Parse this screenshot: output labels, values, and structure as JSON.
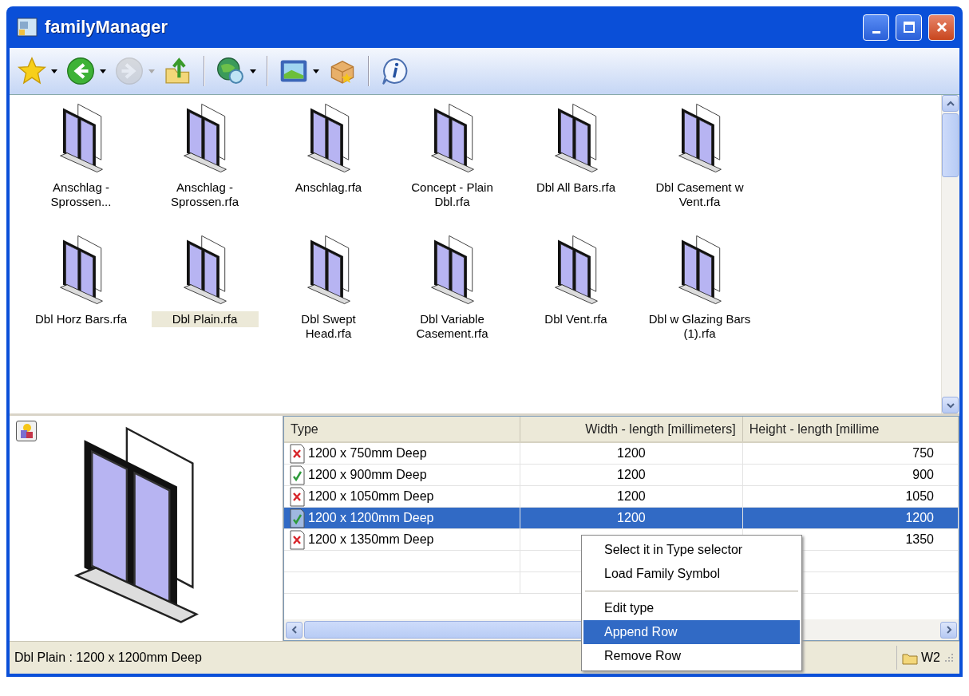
{
  "window": {
    "title": "familyManager"
  },
  "toolbar": [
    {
      "kind": "button",
      "dropdown": true,
      "disabled": false
    },
    {
      "kind": "button",
      "dropdown": true,
      "disabled": false
    },
    {
      "kind": "button",
      "dropdown": true,
      "disabled": true
    },
    {
      "kind": "button",
      "dropdown": false,
      "disabled": false
    },
    {
      "kind": "separator"
    },
    {
      "kind": "button",
      "dropdown": true,
      "disabled": false
    },
    {
      "kind": "separator"
    },
    {
      "kind": "button",
      "dropdown": true,
      "disabled": false
    },
    {
      "kind": "button",
      "dropdown": false,
      "disabled": false
    },
    {
      "kind": "separator"
    },
    {
      "kind": "button",
      "dropdown": false,
      "disabled": false
    }
  ],
  "files": [
    {
      "label": "Anschlag - Sprossen...",
      "selected": false
    },
    {
      "label": "Anschlag - Sprossen.rfa",
      "selected": false
    },
    {
      "label": "Anschlag.rfa",
      "selected": false
    },
    {
      "label": "Concept - Plain Dbl.rfa",
      "selected": false
    },
    {
      "label": "Dbl All Bars.rfa",
      "selected": false
    },
    {
      "label": "Dbl Casement w Vent.rfa",
      "selected": false
    },
    {
      "label": "Dbl Horz Bars.rfa",
      "selected": false
    },
    {
      "label": "Dbl Plain.rfa",
      "selected": true
    },
    {
      "label": "Dbl Swept Head.rfa",
      "selected": false
    },
    {
      "label": "Dbl Variable Casement.rfa",
      "selected": false
    },
    {
      "label": "Dbl Vent.rfa",
      "selected": false
    },
    {
      "label": "Dbl w Glazing Bars (1).rfa",
      "selected": false
    }
  ],
  "table": {
    "columns": [
      "Type",
      "Width - length [millimeters]",
      "Height - length [millime"
    ],
    "rows": [
      {
        "cells": [
          "1200 x 750mm Deep",
          "1200",
          "750"
        ],
        "loaded": false,
        "selected": false
      },
      {
        "cells": [
          "1200 x 900mm Deep",
          "1200",
          "900"
        ],
        "loaded": true,
        "selected": false
      },
      {
        "cells": [
          "1200 x 1050mm Deep",
          "1200",
          "1050"
        ],
        "loaded": false,
        "selected": false
      },
      {
        "cells": [
          "1200 x 1200mm Deep",
          "1200",
          "1200"
        ],
        "loaded": true,
        "selected": true
      },
      {
        "cells": [
          "1200 x 1350mm Deep",
          "",
          "1350"
        ],
        "loaded": false,
        "selected": false
      }
    ]
  },
  "context_menu": [
    {
      "kind": "item",
      "label": "Select it in Type selector",
      "selected": false
    },
    {
      "kind": "item",
      "label": "Load Family Symbol",
      "selected": false
    },
    {
      "kind": "separator"
    },
    {
      "kind": "item",
      "label": "Edit type",
      "selected": false
    },
    {
      "kind": "item",
      "label": "Append Row",
      "selected": true
    },
    {
      "kind": "item",
      "label": "Remove Row",
      "selected": false
    }
  ],
  "status_bar": {
    "text": "Dbl Plain : 1200 x 1200mm Deep",
    "folder": "W2"
  }
}
